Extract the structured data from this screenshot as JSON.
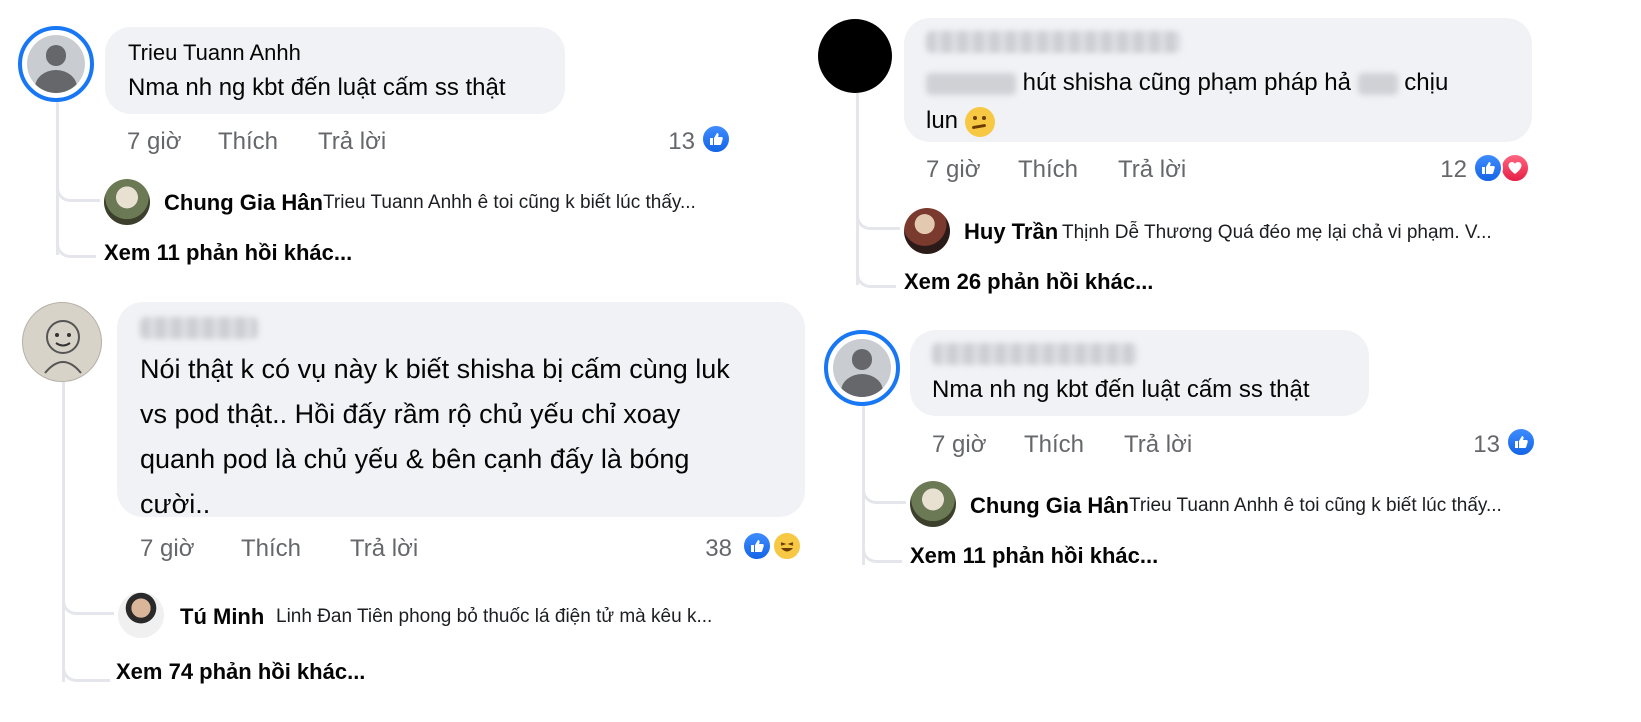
{
  "comments": [
    {
      "author": "Trieu Tuann Anhh",
      "text": "Nma nh ng kbt đến luật cấm ss thật",
      "time": "7 giờ",
      "like": "Thích",
      "reply": "Trả lời",
      "reaction_count": "13",
      "reply_author": "Chung Gia Hân",
      "reply_text": "Trieu Tuann Anhh ê toi cũng k biết lúc thấy...",
      "more_replies": "Xem 11 phản hồi khác..."
    },
    {
      "text_visible": "hút shisha cũng phạm pháp hả",
      "text_visible_2": "chịu",
      "text_line2": "lun",
      "time": "7 giờ",
      "like": "Thích",
      "reply": "Trả lời",
      "reaction_count": "12",
      "reply_author": "Huy Trần",
      "reply_text": "Thịnh Dễ Thương Quá đéo mẹ lại chả vi phạm. V...",
      "more_replies": "Xem 26 phản hồi khác..."
    },
    {
      "text_lines": [
        "Nói thật k có vụ này k biết shisha bị cấm cùng luk",
        "vs pod thật.. Hồi đấy rầm rộ chủ yếu chỉ xoay",
        "quanh pod là chủ yếu & bên cạnh đấy là bóng",
        "cười.."
      ],
      "time": "7 giờ",
      "like": "Thích",
      "reply": "Trả lời",
      "reaction_count": "38",
      "reply_author": "Tú Minh",
      "reply_text": "Linh Đan Tiên phong bỏ thuốc lá điện tử mà kêu k...",
      "more_replies": "Xem 74 phản hồi khác..."
    },
    {
      "text": "Nma nh ng kbt đến luật cấm ss thật",
      "time": "7 giờ",
      "like": "Thích",
      "reply": "Trả lời",
      "reaction_count": "13",
      "reply_author": "Chung Gia Hân",
      "reply_text": "Trieu Tuann Anhh ê toi cũng k biết lúc thấy...",
      "more_replies": "Xem 11 phản hồi khác..."
    }
  ],
  "icons": {
    "like": "thumbs-up-icon",
    "love": "heart-icon",
    "haha": "laughing-face-icon",
    "thinking": "thinking-face-emoji"
  },
  "colors": {
    "bubble": "#f0f2f5",
    "meta_text": "#65676b",
    "like_blue": "#1877f2",
    "love_red": "#e61e45",
    "thread_line": "#e4e6eb"
  }
}
